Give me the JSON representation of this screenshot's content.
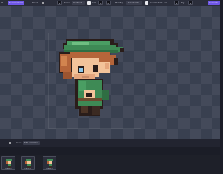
{
  "toolbar": {
    "frame_count": "32",
    "redimension_label": "Redimensionar",
    "pincel_label": "Pincel",
    "pincel_value": "1",
    "forma_label": "Forma",
    "forma_value": "Cuadrado",
    "grid_label": "Grid",
    "grid_w": "8",
    "grid_h": "8",
    "tile_map_label": "Tile Map",
    "tile_map_value": "Desactivado",
    "capa_label": "Capa Cebolla: Ant",
    "capa_ant_value": "1",
    "sig_label": "Sig",
    "sig_value": "1",
    "right_button": "Comenza"
  },
  "animation": {
    "loop_label": "Loop:",
    "loop_value": "Full Animation"
  },
  "frames": [
    {
      "label": "Frame 1"
    },
    {
      "label": "Frame 2"
    },
    {
      "label": "Frame 3"
    }
  ],
  "colors": {
    "accent": "#6f57e6",
    "slider": "#e0304a",
    "hat": "#3e8a55",
    "hair": "#b5653a",
    "skin": "#f3c39a"
  }
}
